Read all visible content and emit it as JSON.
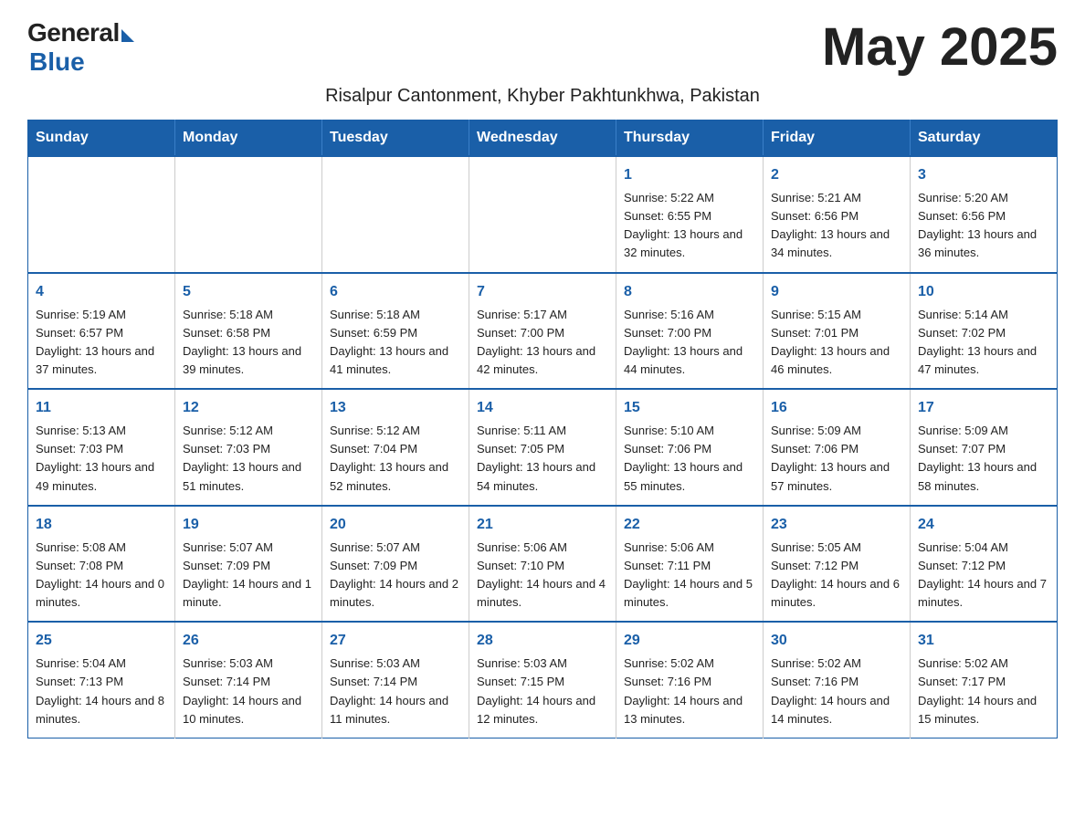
{
  "header": {
    "logo": {
      "general": "General",
      "blue": "Blue"
    },
    "month_title": "May 2025",
    "subtitle": "Risalpur Cantonment, Khyber Pakhtunkhwa, Pakistan"
  },
  "weekdays": [
    "Sunday",
    "Monday",
    "Tuesday",
    "Wednesday",
    "Thursday",
    "Friday",
    "Saturday"
  ],
  "weeks": [
    [
      {
        "day": "",
        "info": ""
      },
      {
        "day": "",
        "info": ""
      },
      {
        "day": "",
        "info": ""
      },
      {
        "day": "",
        "info": ""
      },
      {
        "day": "1",
        "info": "Sunrise: 5:22 AM\nSunset: 6:55 PM\nDaylight: 13 hours and 32 minutes."
      },
      {
        "day": "2",
        "info": "Sunrise: 5:21 AM\nSunset: 6:56 PM\nDaylight: 13 hours and 34 minutes."
      },
      {
        "day": "3",
        "info": "Sunrise: 5:20 AM\nSunset: 6:56 PM\nDaylight: 13 hours and 36 minutes."
      }
    ],
    [
      {
        "day": "4",
        "info": "Sunrise: 5:19 AM\nSunset: 6:57 PM\nDaylight: 13 hours and 37 minutes."
      },
      {
        "day": "5",
        "info": "Sunrise: 5:18 AM\nSunset: 6:58 PM\nDaylight: 13 hours and 39 minutes."
      },
      {
        "day": "6",
        "info": "Sunrise: 5:18 AM\nSunset: 6:59 PM\nDaylight: 13 hours and 41 minutes."
      },
      {
        "day": "7",
        "info": "Sunrise: 5:17 AM\nSunset: 7:00 PM\nDaylight: 13 hours and 42 minutes."
      },
      {
        "day": "8",
        "info": "Sunrise: 5:16 AM\nSunset: 7:00 PM\nDaylight: 13 hours and 44 minutes."
      },
      {
        "day": "9",
        "info": "Sunrise: 5:15 AM\nSunset: 7:01 PM\nDaylight: 13 hours and 46 minutes."
      },
      {
        "day": "10",
        "info": "Sunrise: 5:14 AM\nSunset: 7:02 PM\nDaylight: 13 hours and 47 minutes."
      }
    ],
    [
      {
        "day": "11",
        "info": "Sunrise: 5:13 AM\nSunset: 7:03 PM\nDaylight: 13 hours and 49 minutes."
      },
      {
        "day": "12",
        "info": "Sunrise: 5:12 AM\nSunset: 7:03 PM\nDaylight: 13 hours and 51 minutes."
      },
      {
        "day": "13",
        "info": "Sunrise: 5:12 AM\nSunset: 7:04 PM\nDaylight: 13 hours and 52 minutes."
      },
      {
        "day": "14",
        "info": "Sunrise: 5:11 AM\nSunset: 7:05 PM\nDaylight: 13 hours and 54 minutes."
      },
      {
        "day": "15",
        "info": "Sunrise: 5:10 AM\nSunset: 7:06 PM\nDaylight: 13 hours and 55 minutes."
      },
      {
        "day": "16",
        "info": "Sunrise: 5:09 AM\nSunset: 7:06 PM\nDaylight: 13 hours and 57 minutes."
      },
      {
        "day": "17",
        "info": "Sunrise: 5:09 AM\nSunset: 7:07 PM\nDaylight: 13 hours and 58 minutes."
      }
    ],
    [
      {
        "day": "18",
        "info": "Sunrise: 5:08 AM\nSunset: 7:08 PM\nDaylight: 14 hours and 0 minutes."
      },
      {
        "day": "19",
        "info": "Sunrise: 5:07 AM\nSunset: 7:09 PM\nDaylight: 14 hours and 1 minute."
      },
      {
        "day": "20",
        "info": "Sunrise: 5:07 AM\nSunset: 7:09 PM\nDaylight: 14 hours and 2 minutes."
      },
      {
        "day": "21",
        "info": "Sunrise: 5:06 AM\nSunset: 7:10 PM\nDaylight: 14 hours and 4 minutes."
      },
      {
        "day": "22",
        "info": "Sunrise: 5:06 AM\nSunset: 7:11 PM\nDaylight: 14 hours and 5 minutes."
      },
      {
        "day": "23",
        "info": "Sunrise: 5:05 AM\nSunset: 7:12 PM\nDaylight: 14 hours and 6 minutes."
      },
      {
        "day": "24",
        "info": "Sunrise: 5:04 AM\nSunset: 7:12 PM\nDaylight: 14 hours and 7 minutes."
      }
    ],
    [
      {
        "day": "25",
        "info": "Sunrise: 5:04 AM\nSunset: 7:13 PM\nDaylight: 14 hours and 8 minutes."
      },
      {
        "day": "26",
        "info": "Sunrise: 5:03 AM\nSunset: 7:14 PM\nDaylight: 14 hours and 10 minutes."
      },
      {
        "day": "27",
        "info": "Sunrise: 5:03 AM\nSunset: 7:14 PM\nDaylight: 14 hours and 11 minutes."
      },
      {
        "day": "28",
        "info": "Sunrise: 5:03 AM\nSunset: 7:15 PM\nDaylight: 14 hours and 12 minutes."
      },
      {
        "day": "29",
        "info": "Sunrise: 5:02 AM\nSunset: 7:16 PM\nDaylight: 14 hours and 13 minutes."
      },
      {
        "day": "30",
        "info": "Sunrise: 5:02 AM\nSunset: 7:16 PM\nDaylight: 14 hours and 14 minutes."
      },
      {
        "day": "31",
        "info": "Sunrise: 5:02 AM\nSunset: 7:17 PM\nDaylight: 14 hours and 15 minutes."
      }
    ]
  ]
}
